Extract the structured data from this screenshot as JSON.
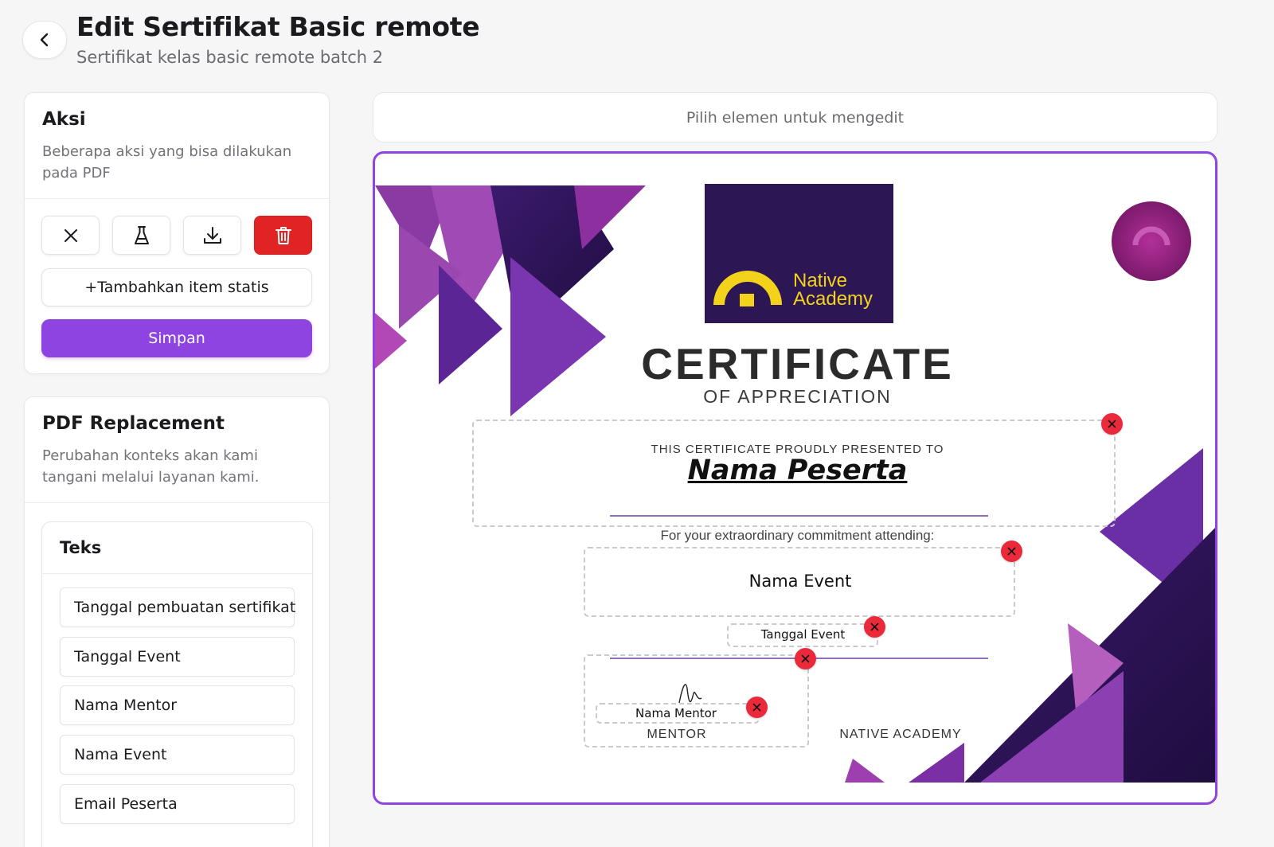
{
  "header": {
    "title": "Edit Sertifikat Basic remote",
    "subtitle": "Sertifikat kelas basic remote batch 2"
  },
  "aksi": {
    "title": "Aksi",
    "description": "Beberapa aksi yang bisa dilakukan pada PDF",
    "icons": [
      "close-icon",
      "flask-icon",
      "download-icon",
      "trash-icon"
    ],
    "add_static_label": "+Tambahkan item statis",
    "save_label": "Simpan"
  },
  "pdf_replacement": {
    "title": "PDF Replacement",
    "description": "Perubahan konteks akan kami tangani melalui layanan kami.",
    "teks": {
      "title": "Teks",
      "items": [
        "Tanggal pembuatan sertifikat",
        "Tanggal Event",
        "Nama Mentor",
        "Nama Event",
        "Email Peserta"
      ]
    }
  },
  "editor": {
    "hint": "Pilih elemen untuk mengedit"
  },
  "certificate": {
    "logo_line1": "Native",
    "logo_line2": "Academy",
    "title": "CERTIFICATE",
    "subtitle": "OF APPRECIATION",
    "presented": "THIS CERTIFICATE PROUDLY PRESENTED TO",
    "participant_name": "Nama Peserta",
    "commitment": "For your extraordinary commitment attending:",
    "event_name": "Nama Event",
    "event_date": "Tanggal Event",
    "mentor_name": "Nama Mentor",
    "mentor_caption": "MENTOR",
    "org_caption": "NATIVE ACADEMY"
  },
  "colors": {
    "accent": "#8e44e0",
    "danger": "#e02424",
    "delete_badge": "#ea2a3b",
    "logo_yellow": "#f2d21b",
    "logo_bg": "#2d1654"
  }
}
